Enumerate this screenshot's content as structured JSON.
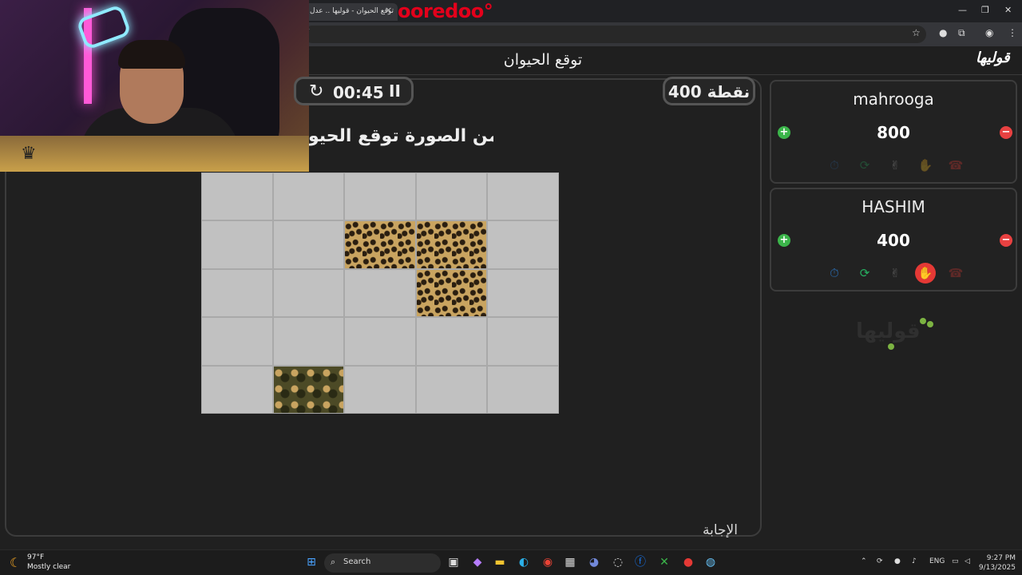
{
  "browser": {
    "tab_title": "توقع الحيوان - قوليها .. عدل",
    "tab_close": "×",
    "banner": "ooredoo°",
    "window_minimize": "—",
    "window_maximize": "❐",
    "window_close": "✕",
    "url_fragment": "/"
  },
  "header": {
    "title": "توقع الحيوان",
    "logo": "قوليها"
  },
  "game": {
    "timer": "00:45",
    "timer_refresh": "↻",
    "timer_pause": "II",
    "points": "400 نقطة",
    "question": "من الصورة توقع الحيو",
    "answer_button": "الإجابة",
    "grid": {
      "rows": 5,
      "cols": 5,
      "revealed": [
        "1-2",
        "1-3",
        "2-3",
        "4-1"
      ],
      "revealed_types": {
        "1-2": "rev",
        "1-3": "rev",
        "2-3": "rev",
        "4-1": "bush"
      }
    }
  },
  "players": [
    {
      "name": "mahrooga",
      "score": "800",
      "plus": "+",
      "minus": "−",
      "powerups": [
        {
          "icon": "⏱",
          "color": "#2b6cb0",
          "active": false
        },
        {
          "icon": "⟳",
          "color": "#27ae60",
          "active": false
        },
        {
          "icon": "✌",
          "color": "#cccccc",
          "active": false
        },
        {
          "icon": "✋",
          "color": "#e53935",
          "active": false
        },
        {
          "icon": "☎",
          "color": "#e53935",
          "active": false
        }
      ]
    },
    {
      "name": "HASHIM",
      "score": "400",
      "plus": "+",
      "minus": "−",
      "powerups": [
        {
          "icon": "⏱",
          "color": "#2b6cb0",
          "active": true
        },
        {
          "icon": "⟳",
          "color": "#27ae60",
          "active": true
        },
        {
          "icon": "✌",
          "color": "#cccccc",
          "active": false
        },
        {
          "icon": "✋",
          "color": "#e53935",
          "active": true
        },
        {
          "icon": "☎",
          "color": "#e53935",
          "active": false
        }
      ]
    }
  ],
  "sidebar_watermark": "قوليها",
  "taskbar": {
    "weather_temp": "97°F",
    "weather_desc": "Mostly clear",
    "search": "Search",
    "lang": "ENG",
    "time": "9:27 PM",
    "date": "9/13/2025"
  }
}
